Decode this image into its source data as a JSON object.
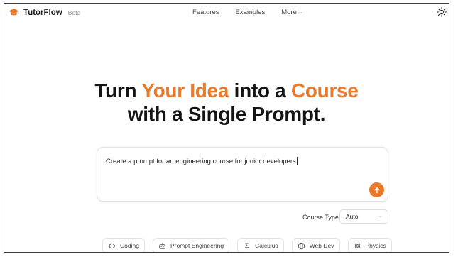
{
  "app": {
    "name": "TutorFlow",
    "badge": "Beta"
  },
  "nav": {
    "items": [
      {
        "label": "Features"
      },
      {
        "label": "Examples"
      },
      {
        "label": "More"
      }
    ]
  },
  "hero": {
    "line1_prefix": "Turn ",
    "line1_accent1": "Your Idea",
    "line1_middle": " into a ",
    "line1_accent2": "Course",
    "line2": "with a Single Prompt."
  },
  "prompt": {
    "value": "Create a prompt for an engineering course for junior developers"
  },
  "course_type": {
    "label": "Course Type",
    "selected": "Auto"
  },
  "chips": [
    {
      "label": "Coding",
      "icon": "code-icon"
    },
    {
      "label": "Prompt Engineering",
      "icon": "robot-icon"
    },
    {
      "label": "Calculus",
      "icon": "sigma-icon"
    },
    {
      "label": "Web Dev",
      "icon": "globe-icon"
    },
    {
      "label": "Physics",
      "icon": "atom-icon"
    }
  ],
  "colors": {
    "accent": "#ea7a2b",
    "text": "#141414",
    "border": "#e3e3e3"
  }
}
